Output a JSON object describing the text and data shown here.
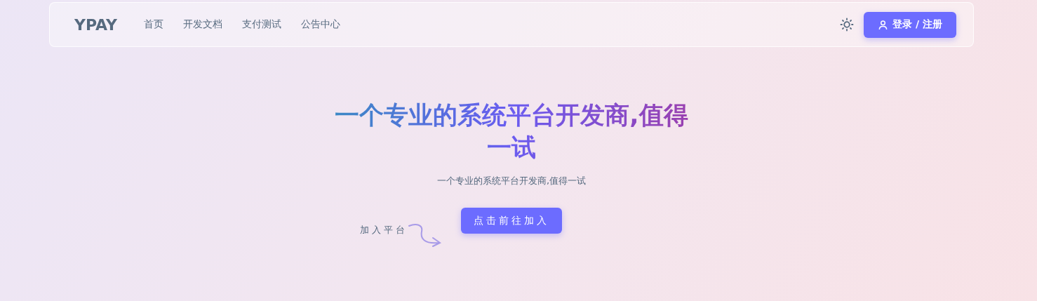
{
  "header": {
    "logo": "YPAY",
    "nav": [
      "首页",
      "开发文档",
      "支付测试",
      "公告中心"
    ],
    "login_button": "登录 / 注册"
  },
  "hero": {
    "title": "一个专业的系统平台开发商,值得一试",
    "subtitle": "一个专业的系统平台开发商,值得一试",
    "cta_button": "点击前往加入",
    "side_note": "加入平台"
  }
}
